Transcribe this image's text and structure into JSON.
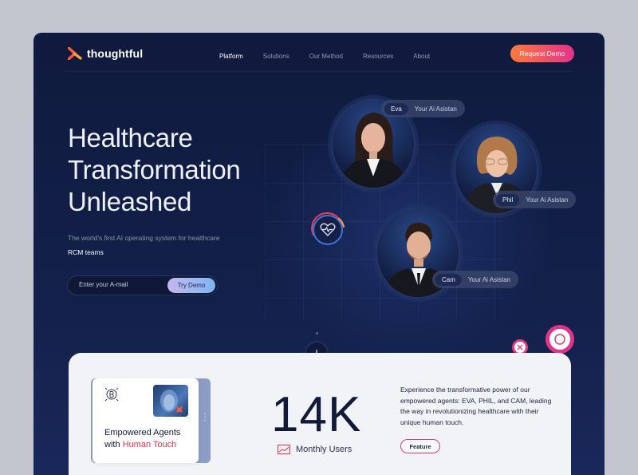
{
  "brand": {
    "name": "thoughtful"
  },
  "nav": {
    "items": [
      "Platform",
      "Solutions",
      "Our Method",
      "Resources",
      "About"
    ]
  },
  "header": {
    "request_demo": "Request Demo"
  },
  "hero": {
    "title_lines": [
      "Healthcare",
      "Transformation",
      "Unleashed"
    ],
    "subtitle_pre": "The world's first AI operating system for healthcare",
    "subtitle_highlight": "RCM teams",
    "email_placeholder": "Enter your A-mail",
    "cta": "Try Demo"
  },
  "agents": [
    {
      "name": "Eva",
      "role": "Your Ai Asistan"
    },
    {
      "name": "Phil",
      "role": "Your Ai Asistan"
    },
    {
      "name": "Cam",
      "role": "Your Ai Asistan"
    }
  ],
  "stats": {
    "card_title_pre": "Empowered Agents with",
    "card_title_highlight": "Human Touch",
    "big_number": "14K",
    "metric_label": "Monthly Users",
    "description": "Experience the transformative power of our empowered agents: EVA, PHIL, and CAM, leading the way in revolutionizing healthcare with their unique human touch.",
    "feature_button": "Feature"
  },
  "colors": {
    "background": "#c4c6cf",
    "hero_bg": "#0f1a3d",
    "accent_gradient_start": "#ff7a3d",
    "accent_gradient_end": "#e0338a",
    "highlight_red": "#e5334a"
  },
  "icons": [
    "logo-icon",
    "heart-pulse-icon",
    "arrow-down-icon",
    "bitcoin-icon",
    "chart-icon",
    "kebab-icon"
  ]
}
